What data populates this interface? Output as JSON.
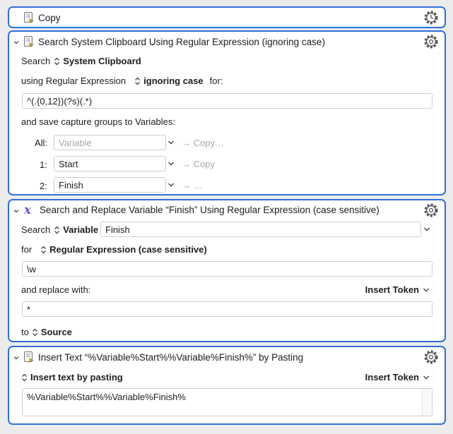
{
  "panel_copy": {
    "title": "Copy"
  },
  "panel_search": {
    "title": "Search System Clipboard Using Regular Expression (ignoring case)",
    "search_label": "Search",
    "source_value": "System Clipboard",
    "using_label": "using Regular Expression",
    "mode_value": "ignoring case",
    "for_label": "for:",
    "regex": "^(.{0,12})(?s)(.*)",
    "save_label": "and save capture groups to Variables:",
    "groups": [
      {
        "label": "All:",
        "value": "",
        "placeholder": "Variable",
        "action": "→ Copy…"
      },
      {
        "label": "1:",
        "value": "Start",
        "placeholder": "",
        "action": "→ Copy"
      },
      {
        "label": "2:",
        "value": "Finish",
        "placeholder": "",
        "action": "→ …"
      }
    ]
  },
  "panel_replace": {
    "title": "Search and Replace Variable “Finish” Using Regular Expression (case sensitive)",
    "search_label": "Search",
    "source_value": "Variable",
    "variable_name": "Finish",
    "for_label": "for",
    "mode_value": "Regular Expression (case sensitive)",
    "regex": "\\w",
    "replace_label": "and replace with:",
    "insert_token": "Insert Token",
    "replacement": "*",
    "to_label": "to",
    "target_value": "Source"
  },
  "panel_insert": {
    "title": "Insert Text “%Variable%Start%%Variable%Finish%” by Pasting",
    "mode_value": "Insert text by pasting",
    "insert_token": "Insert Token",
    "text": "%Variable%Start%%Variable%Finish%"
  },
  "colors": {
    "selection_border": "#2f6fd6",
    "background": "#ececec",
    "muted_text": "#a8a8a8"
  },
  "icons": [
    "disclosure-chevron-icon",
    "document-action-icon",
    "gear-icon",
    "variable-x-icon",
    "popup-updown-icon",
    "chevron-down-icon"
  ]
}
